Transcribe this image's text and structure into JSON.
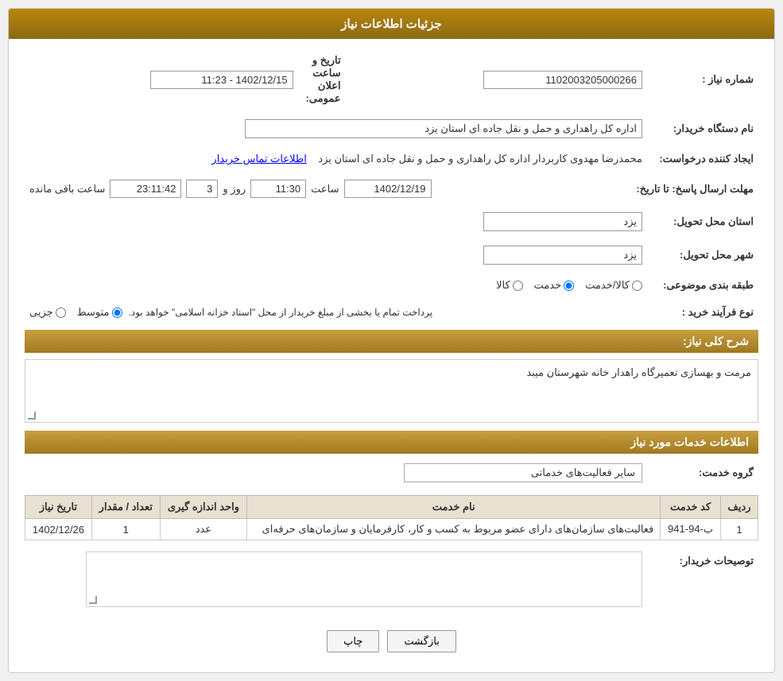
{
  "header": {
    "title": "جزئیات اطلاعات نیاز"
  },
  "fields": {
    "niaaz_number_label": "شماره نیاز :",
    "niaaz_number_value": "1102003205000266",
    "buyer_org_label": "نام دستگاه خریدار:",
    "buyer_org_value": "اداره کل راهداری و حمل و نقل جاده ای استان یزد",
    "requester_label": "ایجاد کننده درخواست:",
    "requester_value": "محمدرضا مهدوی کاربردار اداره کل راهداری و حمل و نقل جاده ای استان یزد",
    "contact_link": "اطلاعات تماس خریدار",
    "deadline_label": "مهلت ارسال پاسخ: تا تاریخ:",
    "deadline_date": "1402/12/19",
    "deadline_time_label": "ساعت",
    "deadline_time": "11:30",
    "deadline_days_label": "روز و",
    "deadline_days": "3",
    "deadline_remaining_label": "ساعت باقی مانده",
    "deadline_remaining": "23:11:42",
    "province_label": "استان محل تحویل:",
    "province_value": "یزد",
    "city_label": "شهر محل تحویل:",
    "city_value": "یزد",
    "category_label": "طبقه بندی موضوعی:",
    "category_options": [
      {
        "label": "کالا",
        "value": "kala"
      },
      {
        "label": "خدمت",
        "value": "khedmat"
      },
      {
        "label": "کالا/خدمت",
        "value": "kala_khedmat"
      }
    ],
    "category_selected": "khedmat",
    "process_label": "نوع فرآیند خرید :",
    "process_options": [
      {
        "label": "جزیی",
        "value": "jozi"
      },
      {
        "label": "متوسط",
        "value": "motevaset"
      }
    ],
    "process_selected": "motevaset",
    "process_note": "پرداخت تمام یا بخشی از مبلغ خریدار از محل \"اسناد خزانه اسلامی\" خواهد بود.",
    "announcement_time_label": "تاریخ و ساعت اعلان عمومی:",
    "announcement_time_value": "1402/12/15 - 11:23",
    "description_section": "شرح کلی نیاز:",
    "description_text": "مرمت و بهسازی تعمیرگاه راهدار خانه شهرستان میبد",
    "service_info_section": "اطلاعات خدمات مورد نیاز",
    "service_group_label": "گروه خدمت:",
    "service_group_value": "سایر فعالیت‌های خدماتی",
    "table": {
      "headers": [
        "ردیف",
        "کد خدمت",
        "نام خدمت",
        "واحد اندازه گیری",
        "تعداد / مقدار",
        "تاریخ نیاز"
      ],
      "rows": [
        {
          "row_num": "1",
          "code": "ب-94-941",
          "name": "فعالیت‌های سازمان‌های دارای عضو مربوط به کسب و کار، کارفرمایان و سازمان‌های حرفه‌ای",
          "unit": "عدد",
          "quantity": "1",
          "date": "1402/12/26"
        }
      ]
    },
    "buyer_comments_label": "توصیحات خریدار:",
    "buyer_comments_value": "",
    "buttons": {
      "print_label": "چاپ",
      "back_label": "بازگشت"
    }
  }
}
